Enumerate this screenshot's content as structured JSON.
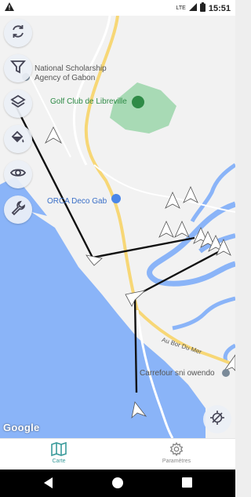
{
  "status_bar": {
    "time": "15:51",
    "network": "LTE"
  },
  "map": {
    "labels": {
      "scholarship": "National Scholarship\nAgency of Gabon",
      "golf": "Golf Club de Libreville",
      "orca": "ORCA Deco Gab",
      "road": "Au Bor Du Mer",
      "carrefour": "Carrefour sni owendo"
    },
    "attribution": "Google"
  },
  "controls": {
    "refresh": "refresh-icon",
    "filter": "filter-icon",
    "layers": "layers-icon",
    "paint": "paint-bucket-icon",
    "visibility": "eye-icon",
    "settings": "wrench-icon",
    "recenter": "crosshair-icon"
  },
  "bottom_nav": {
    "map_label": "Carte",
    "params_label": "Paramètres"
  },
  "colors": {
    "accent": "#3a9b9b",
    "water": "#8ab4f8",
    "park": "#a8dab5"
  }
}
